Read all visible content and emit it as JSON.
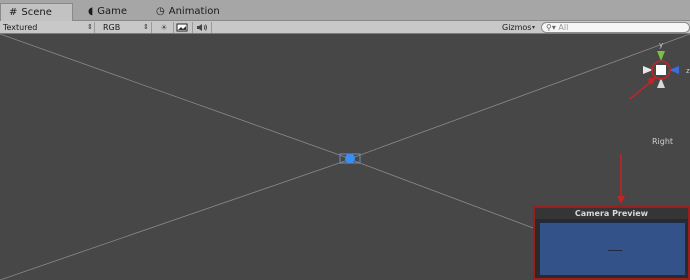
{
  "tabs": [
    {
      "label": "Scene",
      "icon": "scene-grid-icon",
      "active": true
    },
    {
      "label": "Game",
      "icon": "game-pacman-icon",
      "active": false
    },
    {
      "label": "Animation",
      "icon": "animation-clock-icon",
      "active": false
    }
  ],
  "toolbar": {
    "draw_mode": "Textured",
    "render_mode": "RGB",
    "lighting_icon": "sun-icon",
    "image_icon": "image-icon",
    "audio_icon": "speaker-icon",
    "gizmos_label": "Gizmos",
    "search_placeholder": "All"
  },
  "gizmo": {
    "view_label": "Right",
    "axis_y": "y",
    "axis_z": "z"
  },
  "camera_preview": {
    "title": "Camera Preview"
  },
  "colors": {
    "annotation": "#c42424",
    "scene_bg": "#474747",
    "selection": "#3b8ef0"
  }
}
